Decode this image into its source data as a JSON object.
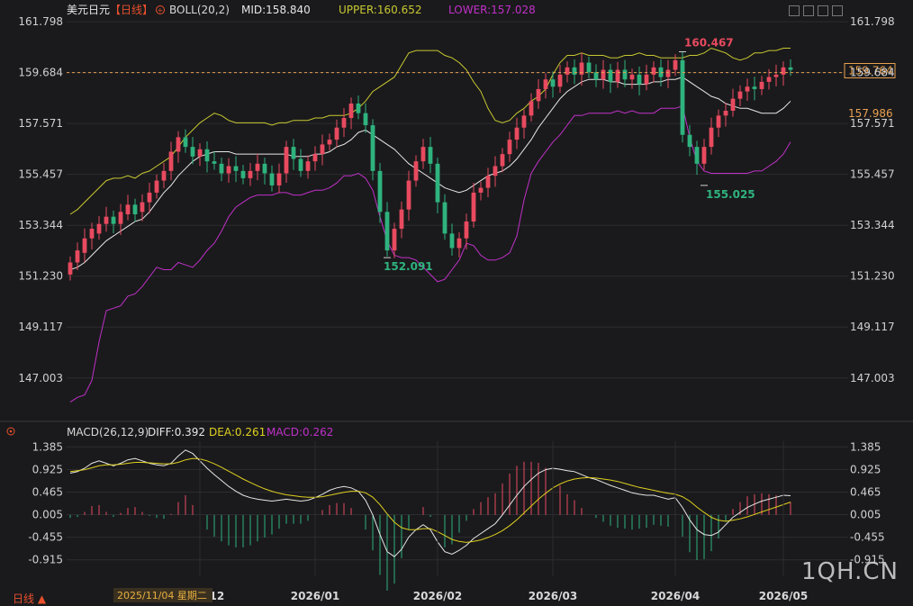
{
  "header": {
    "title": "美元日元",
    "period_tag": "【日线】",
    "indicator": "BOLL(20,2)",
    "mid_label": "MID:158.840",
    "upper_label": "UPPER:160.652",
    "lower_label": "LOWER:157.028"
  },
  "macd_header": {
    "indicator": "MACD(26,12,9)",
    "diff_label": "DIFF:0.392",
    "dea_label": "DEA:0.261",
    "macd_label": "MACD:0.262"
  },
  "footer": {
    "period_button": "日线 ▲",
    "cursor_date": "2025/11/04 星期二"
  },
  "watermark": "1QH.CN",
  "colors": {
    "up": "#e84a5f",
    "down": "#2fb37e",
    "upper": "#c8c832",
    "mid": "#e6e6e6",
    "lower": "#c030c8",
    "dea": "#e0d020",
    "grid": "#2c2c30",
    "price_line": "#e8a050"
  },
  "chart_data": [
    {
      "type": "candlestick",
      "title": "美元日元",
      "y_ticks": [
        161.798,
        159.684,
        157.571,
        155.457,
        153.344,
        151.23,
        149.117,
        147.003
      ],
      "ylim": [
        145.2,
        162.4
      ],
      "x_ticks": [
        "2025/12",
        "2026/01",
        "2026/02",
        "2026/03",
        "2026/04",
        "2026/05"
      ],
      "last_price": 159.764,
      "mid_value_tag": 157.986,
      "reference_line": 159.684,
      "annotations": [
        {
          "text": "160.467",
          "kind": "high"
        },
        {
          "text": "152.091",
          "kind": "low"
        },
        {
          "text": "155.025",
          "kind": "low"
        }
      ],
      "series": [
        {
          "name": "UPPER",
          "values": [
            153.8,
            154.0,
            154.3,
            154.6,
            154.9,
            155.2,
            155.3,
            155.3,
            155.4,
            155.3,
            155.5,
            155.6,
            155.8,
            156.0,
            156.2,
            156.6,
            157.0,
            157.3,
            157.6,
            157.8,
            158.0,
            157.9,
            157.7,
            157.6,
            157.6,
            157.6,
            157.6,
            157.6,
            157.5,
            157.6,
            157.6,
            157.7,
            157.7,
            157.7,
            157.8,
            157.8,
            157.9,
            157.9,
            157.9,
            158.0,
            158.2,
            158.5,
            158.9,
            159.1,
            159.3,
            159.5,
            160.0,
            160.5,
            160.6,
            160.6,
            160.6,
            160.6,
            160.4,
            160.3,
            160.1,
            159.8,
            159.3,
            158.9,
            158.2,
            157.7,
            157.6,
            157.7,
            158.0,
            158.2,
            158.5,
            158.7,
            159.0,
            159.6,
            160.1,
            160.4,
            160.4,
            160.5,
            160.4,
            160.4,
            160.4,
            160.3,
            160.3,
            160.4,
            160.4,
            160.5,
            160.4,
            160.4,
            160.3,
            160.3,
            160.3,
            160.3,
            160.4,
            160.4,
            160.5,
            160.7,
            160.6,
            160.5,
            160.3,
            160.2,
            160.3,
            160.5,
            160.5,
            160.6,
            160.6,
            160.7,
            160.7
          ]
        },
        {
          "name": "MID",
          "values": [
            151.5,
            151.6,
            151.8,
            152.1,
            152.4,
            152.7,
            152.9,
            153.1,
            153.3,
            153.5,
            153.6,
            153.9,
            154.3,
            154.7,
            155.0,
            155.4,
            155.7,
            156.0,
            156.2,
            156.3,
            156.4,
            156.4,
            156.4,
            156.3,
            156.3,
            156.3,
            156.3,
            156.3,
            156.3,
            156.3,
            156.3,
            156.2,
            156.2,
            156.2,
            156.3,
            156.3,
            156.4,
            156.6,
            156.7,
            156.9,
            157.2,
            157.3,
            157.1,
            156.9,
            156.7,
            156.5,
            156.2,
            155.9,
            155.7,
            155.5,
            155.3,
            155.1,
            154.9,
            154.8,
            154.7,
            154.8,
            155.0,
            155.2,
            155.4,
            155.5,
            155.6,
            155.8,
            156.1,
            156.5,
            156.9,
            157.4,
            157.8,
            158.2,
            158.6,
            158.9,
            159.1,
            159.3,
            159.4,
            159.4,
            159.4,
            159.3,
            159.3,
            159.2,
            159.2,
            159.2,
            159.2,
            159.3,
            159.3,
            159.4,
            159.4,
            159.5,
            159.3,
            159.1,
            158.9,
            158.7,
            158.6,
            158.4,
            158.3,
            158.2,
            158.2,
            158.1,
            158.0,
            158.0,
            158.0,
            158.2,
            158.5
          ]
        },
        {
          "name": "LOWER",
          "values": [
            146.0,
            146.2,
            146.3,
            146.9,
            148.5,
            149.8,
            149.9,
            150.0,
            150.4,
            150.5,
            150.8,
            151.2,
            151.6,
            151.5,
            151.5,
            151.8,
            151.7,
            151.6,
            151.9,
            152.3,
            152.6,
            153.1,
            153.7,
            154.1,
            154.3,
            154.5,
            154.6,
            154.6,
            154.6,
            154.7,
            154.7,
            154.6,
            154.6,
            154.7,
            154.8,
            154.8,
            154.9,
            155.1,
            155.4,
            155.4,
            155.5,
            155.3,
            154.8,
            153.7,
            152.7,
            152.1,
            152.0,
            152.0,
            151.9,
            151.6,
            151.3,
            151.0,
            151.1,
            151.5,
            151.9,
            152.6,
            152.5,
            152.1,
            151.9,
            151.9,
            152.0,
            152.2,
            152.9,
            154.4,
            155.5,
            156.0,
            156.4,
            156.8,
            157.1,
            157.5,
            157.9,
            157.9,
            158.0,
            158.0,
            158.0,
            158.0,
            158.1,
            158.0,
            158.1,
            158.0,
            158.0,
            158.0,
            158.2,
            158.2,
            158.2,
            158.3,
            157.0,
            156.0,
            155.6,
            155.5,
            155.5,
            155.5,
            155.5,
            155.5,
            155.5,
            155.6,
            155.6,
            155.8,
            156.0,
            156.3,
            156.8
          ]
        }
      ],
      "candles": [
        [
          151.3,
          151.8
        ],
        [
          151.8,
          152.3
        ],
        [
          152.2,
          152.8
        ],
        [
          152.8,
          153.2
        ],
        [
          153.0,
          153.4
        ],
        [
          153.4,
          153.7
        ],
        [
          153.7,
          153.4
        ],
        [
          153.4,
          153.9
        ],
        [
          153.8,
          154.2
        ],
        [
          154.2,
          153.8
        ],
        [
          153.9,
          154.3
        ],
        [
          154.3,
          154.7
        ],
        [
          154.7,
          155.2
        ],
        [
          155.2,
          155.6
        ],
        [
          155.6,
          156.4
        ],
        [
          156.4,
          157.0
        ],
        [
          157.0,
          156.6
        ],
        [
          156.6,
          156.2
        ],
        [
          156.2,
          156.5
        ],
        [
          156.5,
          156.0
        ],
        [
          156.0,
          155.9
        ],
        [
          155.9,
          155.5
        ],
        [
          155.5,
          155.8
        ],
        [
          155.8,
          155.6
        ],
        [
          155.6,
          155.3
        ],
        [
          155.3,
          155.6
        ],
        [
          155.6,
          155.9
        ],
        [
          155.9,
          155.5
        ],
        [
          155.5,
          155.0
        ],
        [
          155.0,
          155.5
        ],
        [
          155.5,
          156.6
        ],
        [
          156.6,
          156.1
        ],
        [
          156.1,
          155.6
        ],
        [
          155.6,
          156.0
        ],
        [
          156.0,
          156.3
        ],
        [
          156.3,
          156.7
        ],
        [
          156.7,
          156.9
        ],
        [
          156.9,
          157.4
        ],
        [
          157.4,
          157.8
        ],
        [
          157.8,
          158.4
        ],
        [
          158.4,
          158.0
        ],
        [
          158.0,
          157.5
        ],
        [
          157.5,
          155.6
        ],
        [
          155.6,
          153.9
        ],
        [
          153.9,
          152.3
        ],
        [
          152.3,
          153.2
        ],
        [
          153.2,
          154.0
        ],
        [
          154.0,
          155.2
        ],
        [
          155.2,
          156.0
        ],
        [
          156.0,
          156.6
        ],
        [
          156.6,
          155.9
        ],
        [
          155.9,
          154.3
        ],
        [
          154.3,
          153.0
        ],
        [
          153.0,
          152.4
        ],
        [
          152.4,
          152.8
        ],
        [
          152.8,
          153.5
        ],
        [
          153.5,
          154.7
        ],
        [
          154.7,
          154.9
        ],
        [
          154.9,
          155.4
        ],
        [
          155.4,
          155.8
        ],
        [
          155.8,
          156.3
        ],
        [
          156.3,
          156.9
        ],
        [
          156.9,
          157.4
        ],
        [
          157.4,
          157.9
        ],
        [
          157.9,
          158.5
        ],
        [
          158.5,
          159.0
        ],
        [
          159.0,
          159.4
        ],
        [
          159.4,
          159.1
        ],
        [
          159.1,
          159.6
        ],
        [
          159.6,
          159.9
        ],
        [
          159.9,
          159.6
        ],
        [
          159.6,
          160.1
        ],
        [
          160.1,
          159.7
        ],
        [
          159.7,
          159.4
        ],
        [
          159.4,
          159.8
        ],
        [
          159.8,
          159.3
        ],
        [
          159.3,
          159.8
        ],
        [
          159.8,
          159.4
        ],
        [
          159.4,
          159.6
        ],
        [
          159.6,
          159.2
        ],
        [
          159.2,
          159.6
        ],
        [
          159.6,
          159.9
        ],
        [
          159.9,
          159.5
        ],
        [
          159.5,
          159.8
        ],
        [
          159.8,
          160.2
        ],
        [
          160.2,
          157.1
        ],
        [
          157.1,
          156.6
        ],
        [
          156.6,
          155.9
        ],
        [
          155.9,
          156.6
        ],
        [
          156.6,
          157.4
        ],
        [
          157.4,
          157.9
        ],
        [
          157.9,
          158.1
        ],
        [
          158.1,
          158.6
        ],
        [
          158.6,
          158.9
        ],
        [
          158.9,
          159.1
        ],
        [
          159.1,
          159.0
        ],
        [
          159.0,
          159.3
        ],
        [
          159.3,
          159.5
        ],
        [
          159.5,
          159.6
        ],
        [
          159.6,
          159.9
        ],
        [
          159.9,
          159.8
        ]
      ]
    },
    {
      "type": "macd",
      "title": "MACD(26,12,9)",
      "y_ticks": [
        1.385,
        0.925,
        0.465,
        0.005,
        -0.455,
        -0.915
      ],
      "ylim": [
        -1.25,
        1.5
      ],
      "series": [
        {
          "name": "DIFF",
          "values": [
            0.85,
            0.88,
            0.95,
            1.05,
            1.1,
            1.05,
            1.0,
            1.05,
            1.12,
            1.15,
            1.1,
            1.05,
            1.02,
            1.0,
            1.05,
            1.2,
            1.32,
            1.25,
            1.1,
            0.95,
            0.82,
            0.7,
            0.58,
            0.48,
            0.4,
            0.35,
            0.32,
            0.3,
            0.28,
            0.3,
            0.32,
            0.3,
            0.28,
            0.3,
            0.35,
            0.42,
            0.5,
            0.55,
            0.58,
            0.55,
            0.48,
            0.3,
            0.0,
            -0.4,
            -0.75,
            -0.85,
            -0.7,
            -0.45,
            -0.3,
            -0.2,
            -0.3,
            -0.55,
            -0.75,
            -0.8,
            -0.72,
            -0.62,
            -0.48,
            -0.38,
            -0.28,
            -0.18,
            0.0,
            0.2,
            0.4,
            0.58,
            0.72,
            0.85,
            0.92,
            0.95,
            0.93,
            0.9,
            0.88,
            0.82,
            0.76,
            0.72,
            0.66,
            0.6,
            0.55,
            0.5,
            0.45,
            0.42,
            0.4,
            0.4,
            0.36,
            0.32,
            0.35,
            0.15,
            -0.1,
            -0.3,
            -0.4,
            -0.42,
            -0.35,
            -0.2,
            -0.05,
            0.05,
            0.15,
            0.22,
            0.28,
            0.32,
            0.36,
            0.4,
            0.39
          ]
        },
        {
          "name": "DEA",
          "values": [
            0.88,
            0.9,
            0.92,
            0.96,
            1.0,
            1.02,
            1.02,
            1.03,
            1.05,
            1.07,
            1.07,
            1.06,
            1.05,
            1.04,
            1.04,
            1.07,
            1.12,
            1.15,
            1.14,
            1.1,
            1.04,
            0.97,
            0.89,
            0.81,
            0.73,
            0.66,
            0.59,
            0.53,
            0.48,
            0.44,
            0.41,
            0.39,
            0.37,
            0.36,
            0.36,
            0.37,
            0.4,
            0.43,
            0.46,
            0.48,
            0.48,
            0.45,
            0.36,
            0.21,
            0.02,
            -0.15,
            -0.26,
            -0.3,
            -0.3,
            -0.28,
            -0.28,
            -0.34,
            -0.42,
            -0.5,
            -0.54,
            -0.56,
            -0.54,
            -0.51,
            -0.46,
            -0.4,
            -0.32,
            -0.22,
            -0.1,
            0.04,
            0.18,
            0.32,
            0.44,
            0.55,
            0.63,
            0.69,
            0.73,
            0.75,
            0.76,
            0.75,
            0.73,
            0.71,
            0.68,
            0.64,
            0.6,
            0.56,
            0.53,
            0.5,
            0.47,
            0.44,
            0.42,
            0.37,
            0.28,
            0.16,
            0.05,
            -0.05,
            -0.11,
            -0.13,
            -0.11,
            -0.08,
            -0.04,
            0.01,
            0.06,
            0.11,
            0.16,
            0.21,
            0.26
          ]
        }
      ],
      "x_ticks": [
        "2025/12",
        "2026/01",
        "2026/02",
        "2026/03",
        "2026/04",
        "2026/05"
      ]
    }
  ]
}
